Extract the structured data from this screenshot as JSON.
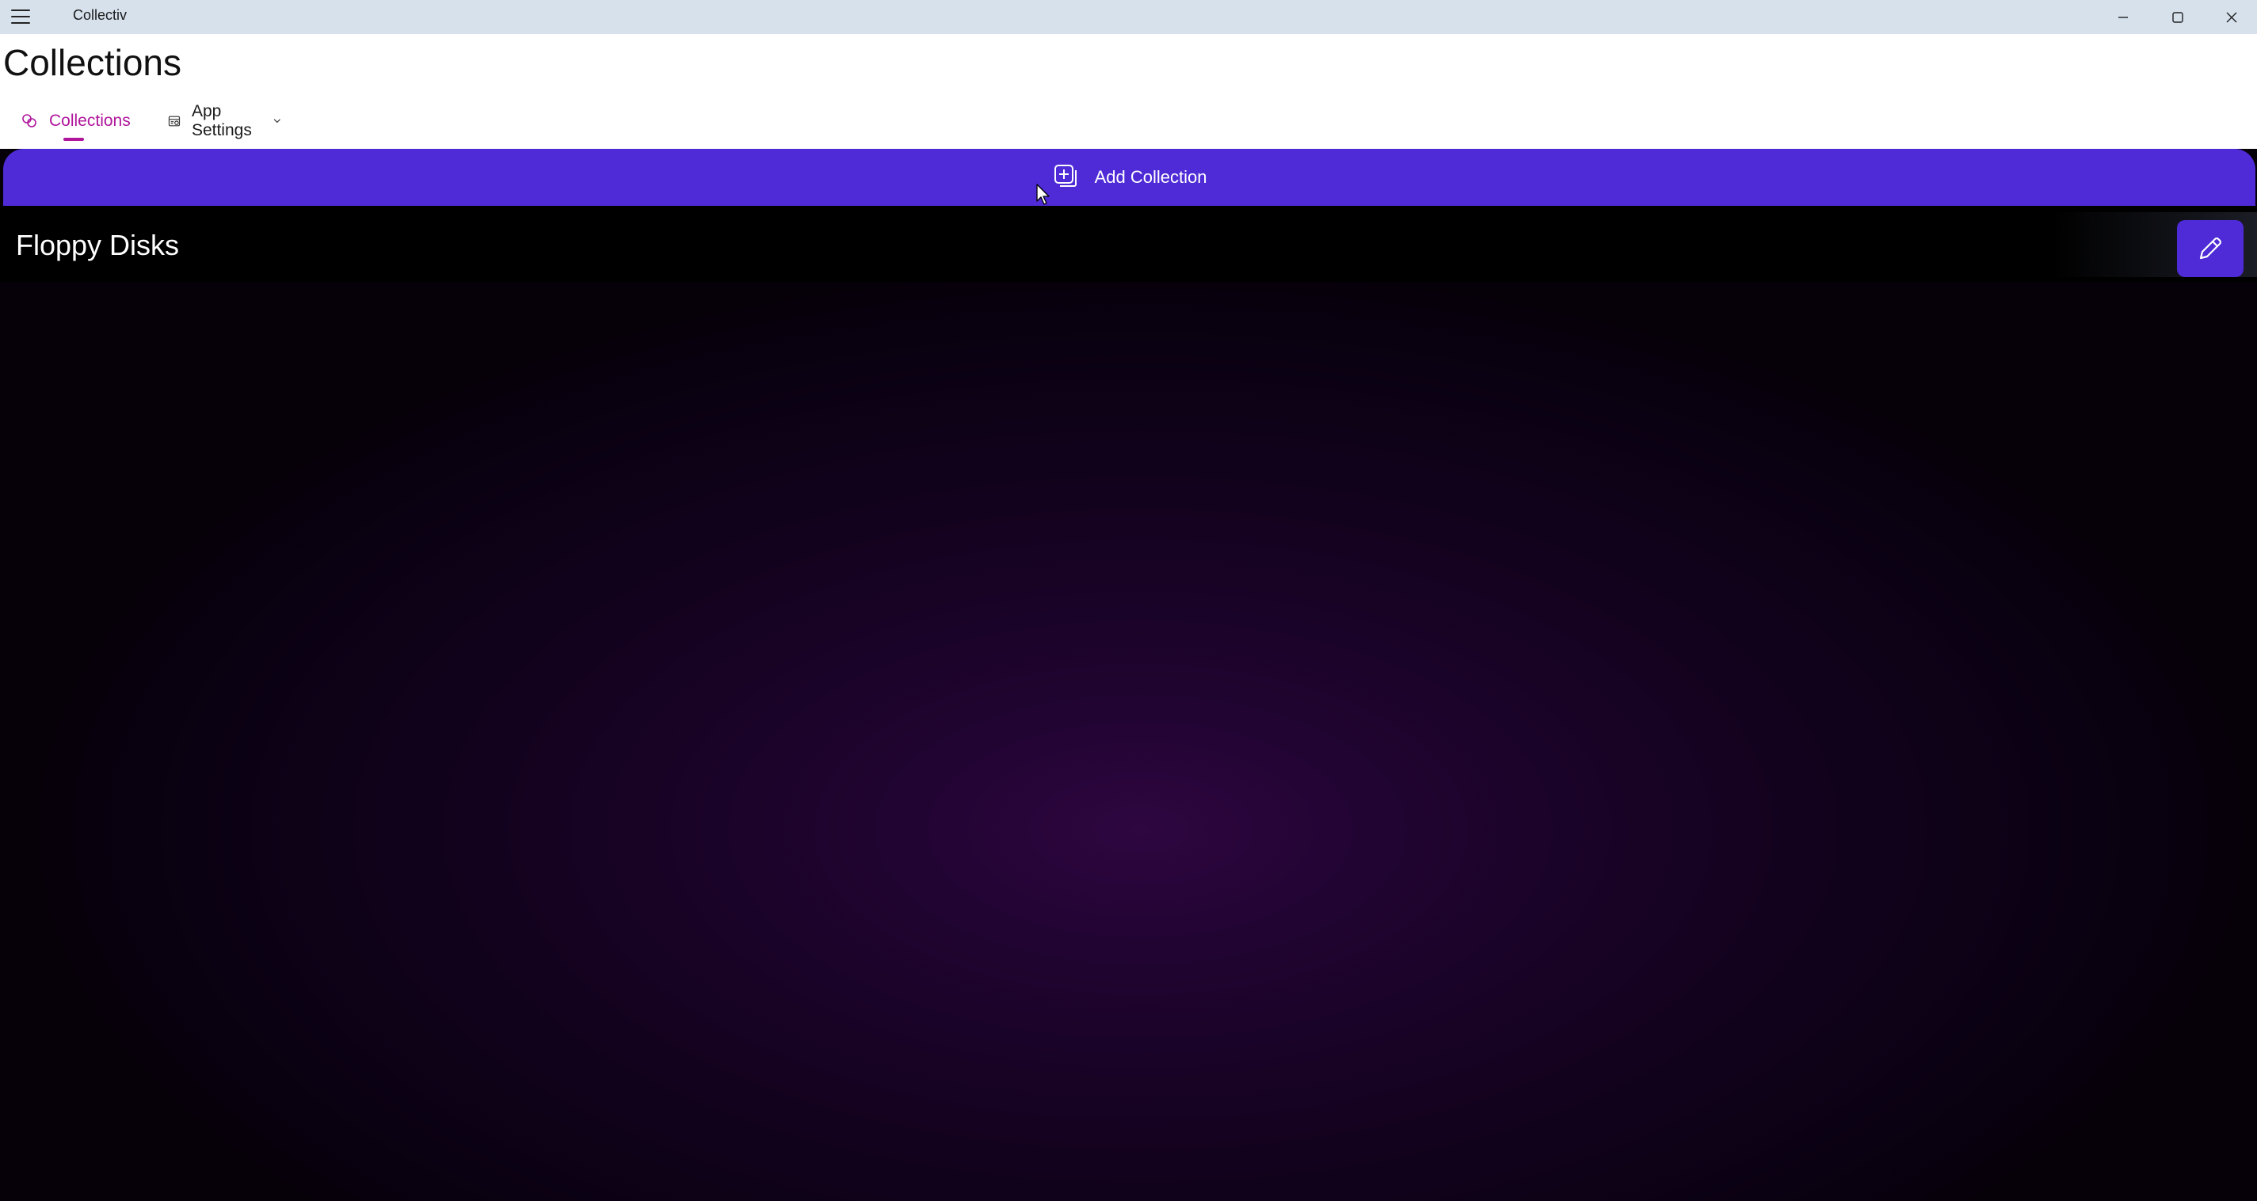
{
  "window": {
    "app_title": "Collectiv",
    "menu_icon": "hamburger-icon",
    "controls": [
      "minimize-icon",
      "maximize-icon",
      "close-icon"
    ]
  },
  "page": {
    "title": "Collections"
  },
  "tabs": [
    {
      "label": "Collections",
      "icon": "collections-icon",
      "selected": true
    },
    {
      "label": "App Settings",
      "icon": "settings-icon",
      "has_dropdown": true
    }
  ],
  "actions": {
    "add_collection_label": "Add Collection",
    "add_collection_icon": "add-square-icon"
  },
  "collections": [
    {
      "name": "Floppy Disks",
      "edit_icon": "pencil-icon"
    }
  ],
  "colors": {
    "accent": "#4e2bd6",
    "tab_selected": "#b0159c",
    "titlebar": "#d6e1ec",
    "background_glow": "#2e0640"
  }
}
